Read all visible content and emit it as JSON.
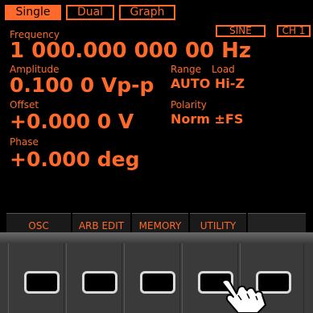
{
  "tabs": [
    {
      "label": "Single",
      "active": true
    },
    {
      "label": "Dual",
      "active": false
    },
    {
      "label": "Graph",
      "active": false
    }
  ],
  "waveform": "SINE",
  "channel": "CH 1",
  "frequency": {
    "label": "Frequency",
    "value": "1 000.000 000 00 Hz"
  },
  "amplitude": {
    "label": "Amplitude",
    "value": "0.100 0 Vp-p"
  },
  "range_load": {
    "range_label": "Range",
    "load_label": "Load",
    "value": "AUTO Hi-Z"
  },
  "offset": {
    "label": "Offset",
    "value": "+0.000 0 V"
  },
  "polarity": {
    "label": "Polarity",
    "value": "Norm ±FS"
  },
  "phase": {
    "label": "Phase",
    "value": "+0.000 deg"
  },
  "softkeys": [
    "OSC",
    "ARB EDIT",
    "MEMORY",
    "UTILITY",
    ""
  ],
  "colors": {
    "accent": "#ff6a2a",
    "screen": "#000000",
    "bezel": "#3a3a3a"
  },
  "icons": {
    "hand": "pointing-hand-icon"
  }
}
